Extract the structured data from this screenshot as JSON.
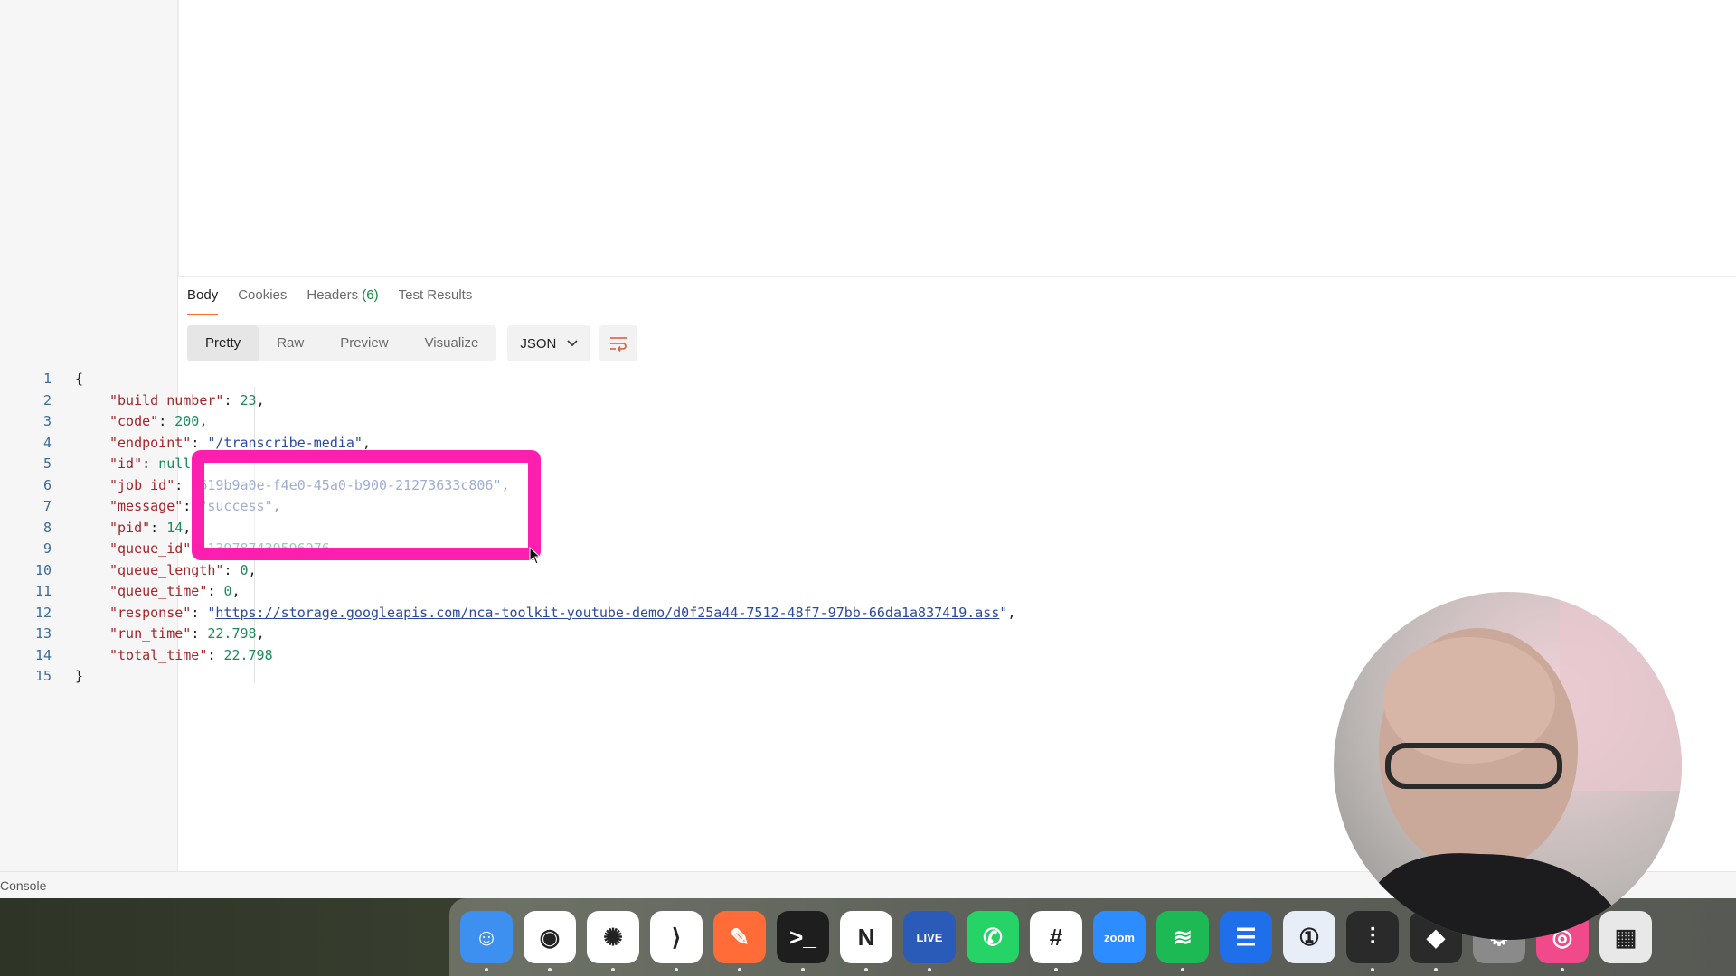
{
  "response": {
    "tabs": [
      {
        "label": "Body",
        "active": true
      },
      {
        "label": "Cookies"
      },
      {
        "label": "Headers",
        "count": "(6)"
      },
      {
        "label": "Test Results"
      }
    ],
    "views": [
      "Pretty",
      "Raw",
      "Preview",
      "Visualize"
    ],
    "format": "JSON",
    "lines": [
      {
        "n": "1",
        "open": "{"
      },
      {
        "n": "2",
        "key": "\"build_number\"",
        "val": "23",
        "type": "num",
        "comma": ","
      },
      {
        "n": "3",
        "key": "\"code\"",
        "val": "200",
        "type": "num",
        "comma": ","
      },
      {
        "n": "4",
        "key": "\"endpoint\"",
        "val": "\"/transcribe-media\"",
        "type": "str",
        "comma": ","
      },
      {
        "n": "5",
        "key": "\"id\"",
        "val": "null",
        "type": "num",
        "comma": ","
      },
      {
        "n": "6",
        "key": "\"job_id\"",
        "val": "\"619b9a0e-f4e0-45a0-b900-21273633c806\"",
        "type": "str",
        "comma": ","
      },
      {
        "n": "7",
        "key": "\"message\"",
        "val": "\"success\"",
        "type": "str",
        "comma": ","
      },
      {
        "n": "8",
        "key": "\"pid\"",
        "val": "14",
        "type": "num",
        "comma": ","
      },
      {
        "n": "9",
        "key": "\"queue_id\"",
        "val": "139787439596976",
        "type": "num",
        "comma": ","
      },
      {
        "n": "10",
        "key": "\"queue_length\"",
        "val": "0",
        "type": "num",
        "comma": ","
      },
      {
        "n": "11",
        "key": "\"queue_time\"",
        "val": "0",
        "type": "num",
        "comma": ","
      },
      {
        "n": "12",
        "key": "\"response\"",
        "val": "https://storage.googleapis.com/nca-toolkit-youtube-demo/d0f25a44-7512-48f7-97bb-66da1a837419.ass",
        "type": "link",
        "comma": ","
      },
      {
        "n": "13",
        "key": "\"run_time\"",
        "val": "22.798",
        "type": "num",
        "comma": ","
      },
      {
        "n": "14",
        "key": "\"total_time\"",
        "val": "22.798",
        "type": "num",
        "comma": ""
      },
      {
        "n": "15",
        "close": "}"
      }
    ]
  },
  "status_bar": {
    "console_label": "Console"
  },
  "dock": {
    "apps": [
      {
        "name": "Finder",
        "icon": "finder-icon",
        "color": "#3d8ff0",
        "glyph": "☺",
        "running": true
      },
      {
        "name": "Chrome",
        "icon": "chrome-icon",
        "color": "#ffffff",
        "glyph": "◉",
        "running": true
      },
      {
        "name": "ChatGPT",
        "icon": "chatgpt-icon",
        "color": "#ffffff",
        "glyph": "✺",
        "running": true
      },
      {
        "name": "VS Code",
        "icon": "vscode-icon",
        "color": "#ffffff",
        "glyph": "⟩",
        "running": true
      },
      {
        "name": "Postman",
        "icon": "postman-icon",
        "color": "#ff6c37",
        "glyph": "✎",
        "running": true
      },
      {
        "name": "Terminal",
        "icon": "terminal-icon",
        "color": "#1e1e1e",
        "glyph": ">_",
        "running": true
      },
      {
        "name": "Notion",
        "icon": "notion-icon",
        "color": "#ffffff",
        "glyph": "N",
        "running": true
      },
      {
        "name": "Live",
        "icon": "live-icon",
        "color": "#2a5bb8",
        "glyph": "LIVE",
        "running": true
      },
      {
        "name": "WhatsApp",
        "icon": "whatsapp-icon",
        "color": "#25d366",
        "glyph": "✆",
        "running": false
      },
      {
        "name": "Slack",
        "icon": "slack-icon",
        "color": "#ffffff",
        "glyph": "#",
        "running": true
      },
      {
        "name": "Zoom",
        "icon": "zoom-icon",
        "color": "#2d8cff",
        "glyph": "zoom",
        "running": false
      },
      {
        "name": "Spotify",
        "icon": "spotify-icon",
        "color": "#1db954",
        "glyph": "≋",
        "running": true
      },
      {
        "name": "Docs",
        "icon": "docs-icon",
        "color": "#1f6feb",
        "glyph": "☰",
        "running": false
      },
      {
        "name": "1Password",
        "icon": "1password-icon",
        "color": "#e8eef8",
        "glyph": "①",
        "running": false
      },
      {
        "name": "UA Console",
        "icon": "ua-console-icon",
        "color": "#2a2a2a",
        "glyph": "⫶",
        "running": true
      },
      {
        "name": "UA Connect",
        "icon": "ua-connect-icon",
        "color": "#2a2a2a",
        "glyph": "◆",
        "running": true
      },
      {
        "name": "Settings",
        "icon": "settings-icon",
        "color": "#8a8a8a",
        "glyph": "⚙",
        "running": false
      },
      {
        "name": "Screen Studio",
        "icon": "screen-studio-icon",
        "color": "#f04a8a",
        "glyph": "◎",
        "running": true
      },
      {
        "name": "Launchpad",
        "icon": "launchpad-icon",
        "color": "#e8e8e8",
        "glyph": "▦",
        "running": false
      }
    ]
  }
}
